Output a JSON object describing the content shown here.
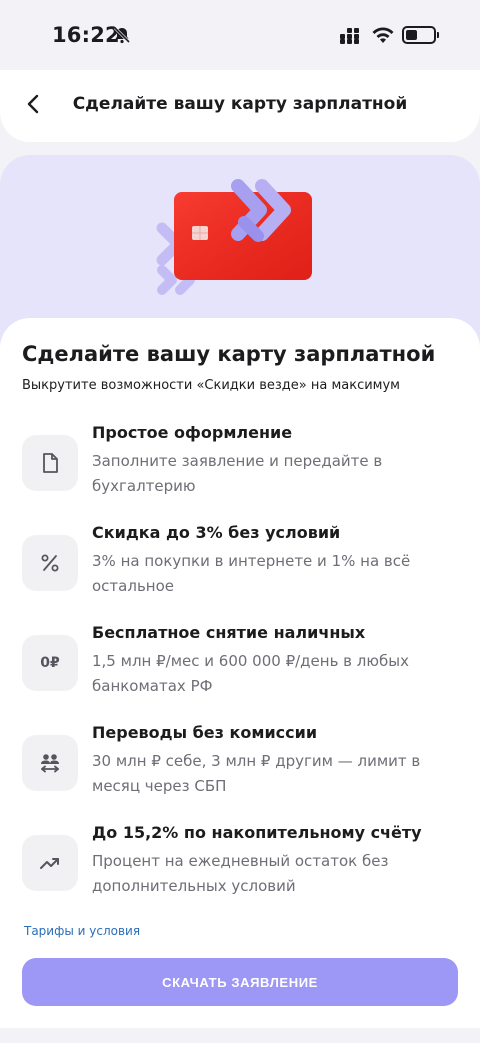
{
  "status_bar": {
    "time": "16:22",
    "icons": [
      "bell-off-icon",
      "signal-icon",
      "wifi-icon",
      "battery-icon"
    ]
  },
  "header": {
    "back_icon": "chevron-left-icon",
    "title": "Сделайте вашу карту зарплатной"
  },
  "hero": {
    "image": "red-card-with-chevrons"
  },
  "main": {
    "title": "Сделайте вашу карту зарплатной",
    "subtitle": "Выкрутите возможности «Скидки везде» на максимум",
    "features": [
      {
        "icon": "document-icon",
        "title": "Простое оформление",
        "description": "Заполните заявление и передайте в бухгалтерию"
      },
      {
        "icon": "percent-icon",
        "title": "Скидка до 3% без условий",
        "description": "3% на покупки в интернете и 1% на всё остальное"
      },
      {
        "icon": "zero-ruble-icon",
        "icon_text": "0₽",
        "title": "Бесплатное снятие наличных",
        "description": "1,5 млн ₽/мес и 600 000 ₽/день в любых банкоматах РФ"
      },
      {
        "icon": "transfer-icon",
        "title": "Переводы без комиссии",
        "description": "30 млн ₽ себе, 3 млн ₽ другим — лимит в месяц через СБП"
      },
      {
        "icon": "trend-up-icon",
        "title": "До 15,2% по накопительному счёту",
        "description": "Процент на ежедневный остаток без дополнительных условий"
      }
    ],
    "terms_link": "Тарифы и условия",
    "download_button": "СКАЧАТЬ ЗАЯВЛЕНИЕ"
  },
  "colors": {
    "accent": "#9d97f6",
    "hero_bg": "#e6e4fa",
    "card_red": "#f0271f",
    "link": "#2b6db8"
  }
}
